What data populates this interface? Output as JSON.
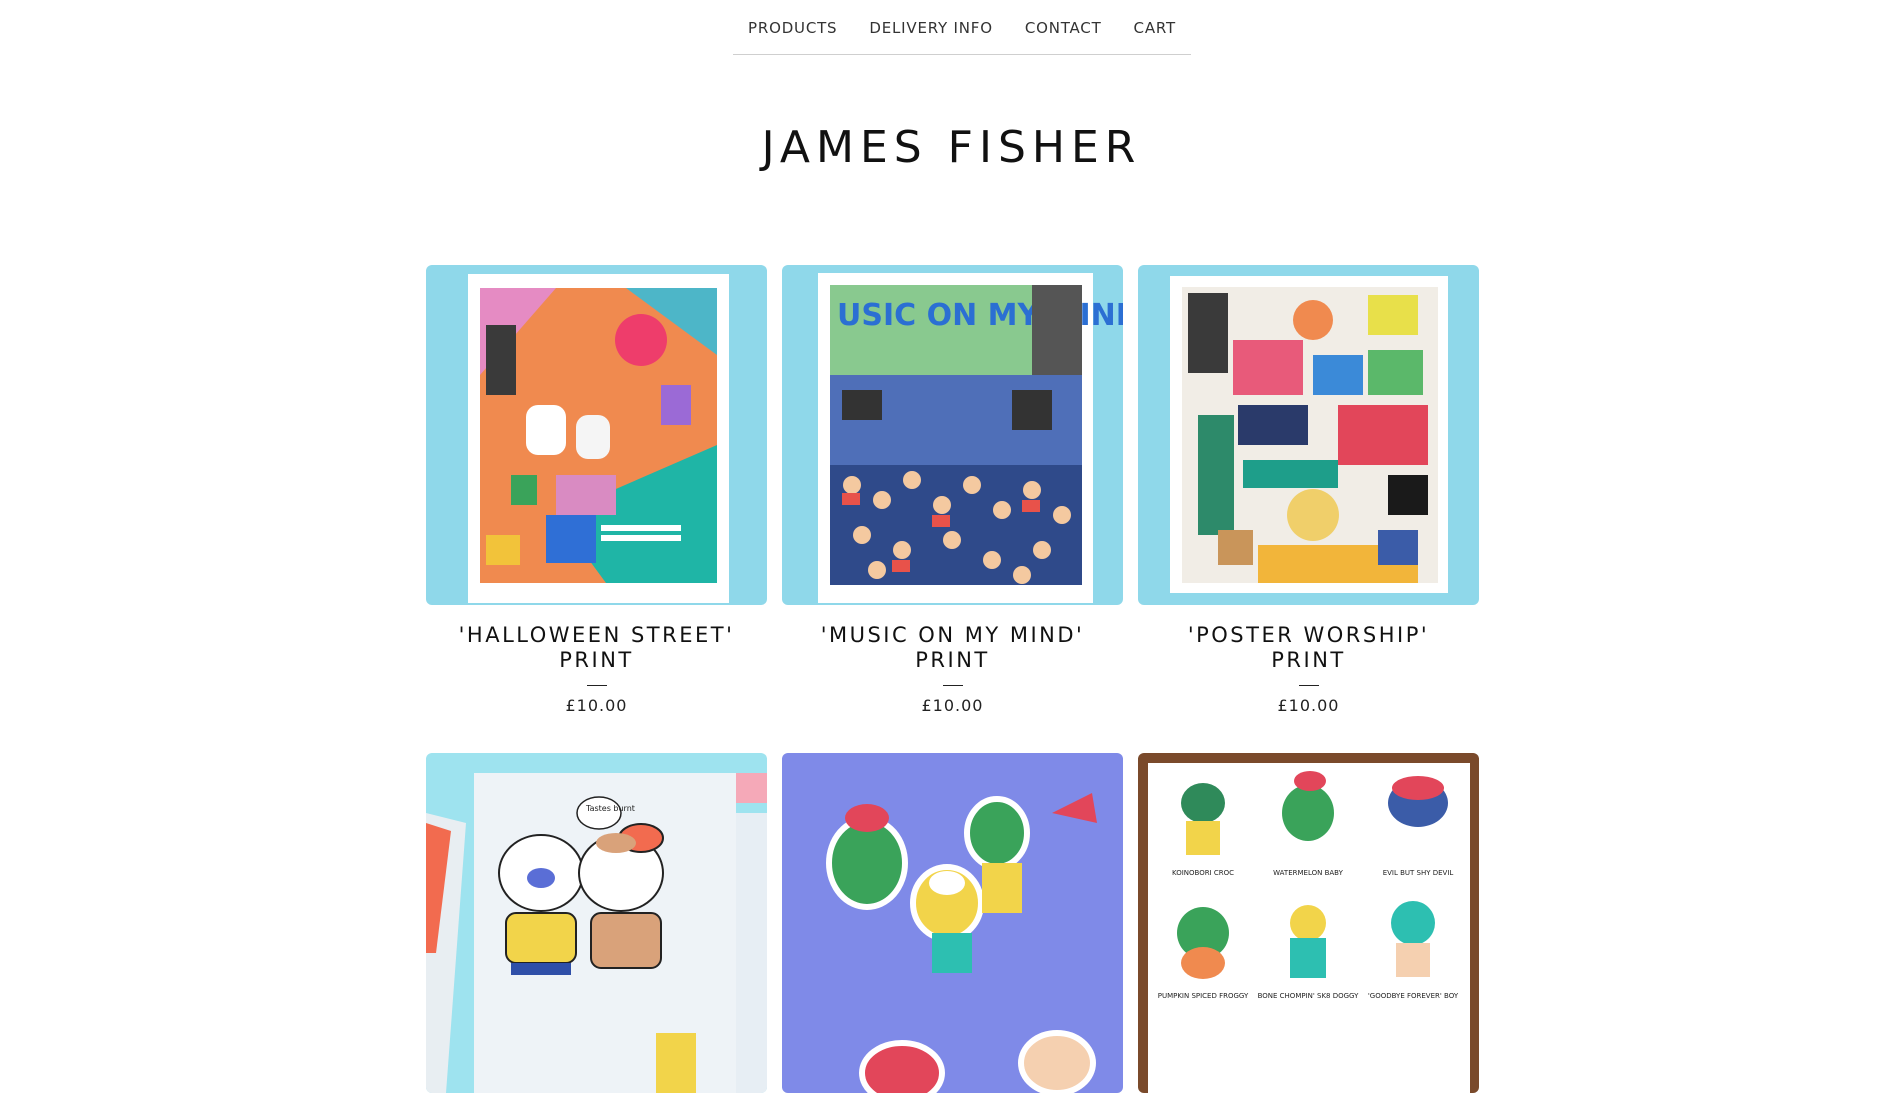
{
  "nav": {
    "items": [
      "PRODUCTS",
      "DELIVERY INFO",
      "CONTACT",
      "CART"
    ]
  },
  "store": {
    "title": "JAMES FISHER"
  },
  "products": [
    {
      "name": "'HALLOWEEN STREET' PRINT",
      "price": "£10.00",
      "bg": "#8fd8ea"
    },
    {
      "name": "'MUSIC ON MY MIND' PRINT",
      "price": "£10.00",
      "bg": "#8fd8ea"
    },
    {
      "name": "'POSTER WORSHIP' PRINT",
      "price": "£10.00",
      "bg": "#8fd8ea"
    },
    {
      "name": "",
      "price": "",
      "bg": "#9ee3ef"
    },
    {
      "name": "",
      "price": "",
      "bg": "#7f8ae8"
    },
    {
      "name": "",
      "price": "",
      "bg": "#7a4a2b"
    }
  ],
  "art_text": {
    "music": "USIC ON MY MIND",
    "stickers_tastes": "Tastes burnt",
    "labels": [
      "KOINOBORI CROC",
      "WATERMELON BABY",
      "EVIL BUT SHY DEVIL",
      "PUMPKIN SPICED FROGGY",
      "BONE CHOMPIN' SK8 DOGGY",
      "'GOODBYE FOREVER' BOY"
    ]
  }
}
